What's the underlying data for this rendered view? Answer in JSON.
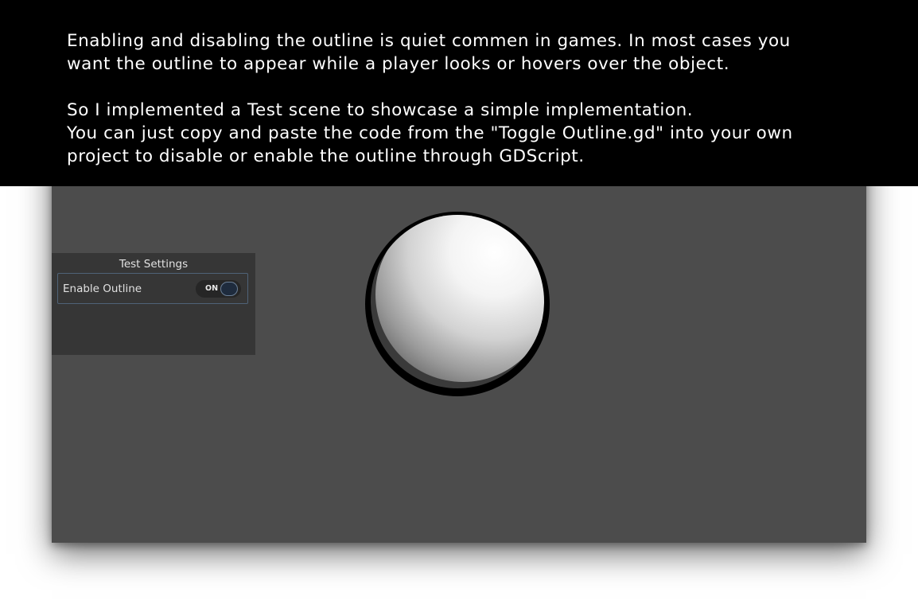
{
  "caption": {
    "line1": "Enabling and disabling the outline is quiet commen in games. In most cases you",
    "line2": "want the outline to appear while a player looks or hovers over the object.",
    "line3": "So I implemented a Test scene to showcase a simple implementation.",
    "line4": "You can just copy and paste the code from the \"Toggle Outline.gd\" into your own",
    "line5": "project to disable or enable the outline through GDScript."
  },
  "settings_panel": {
    "title": "Test Settings",
    "enable_outline": {
      "label": "Enable Outline",
      "toggle_text": "ON",
      "checked": true
    }
  },
  "scene": {
    "object": "outlined-sphere",
    "outline_color": "#000000",
    "background_color": "#4c4c4c"
  },
  "colors": {
    "caption_bg": "#000000",
    "caption_text": "#ffffff",
    "panel_bg": "#363636",
    "row_border": "#4f6378"
  }
}
